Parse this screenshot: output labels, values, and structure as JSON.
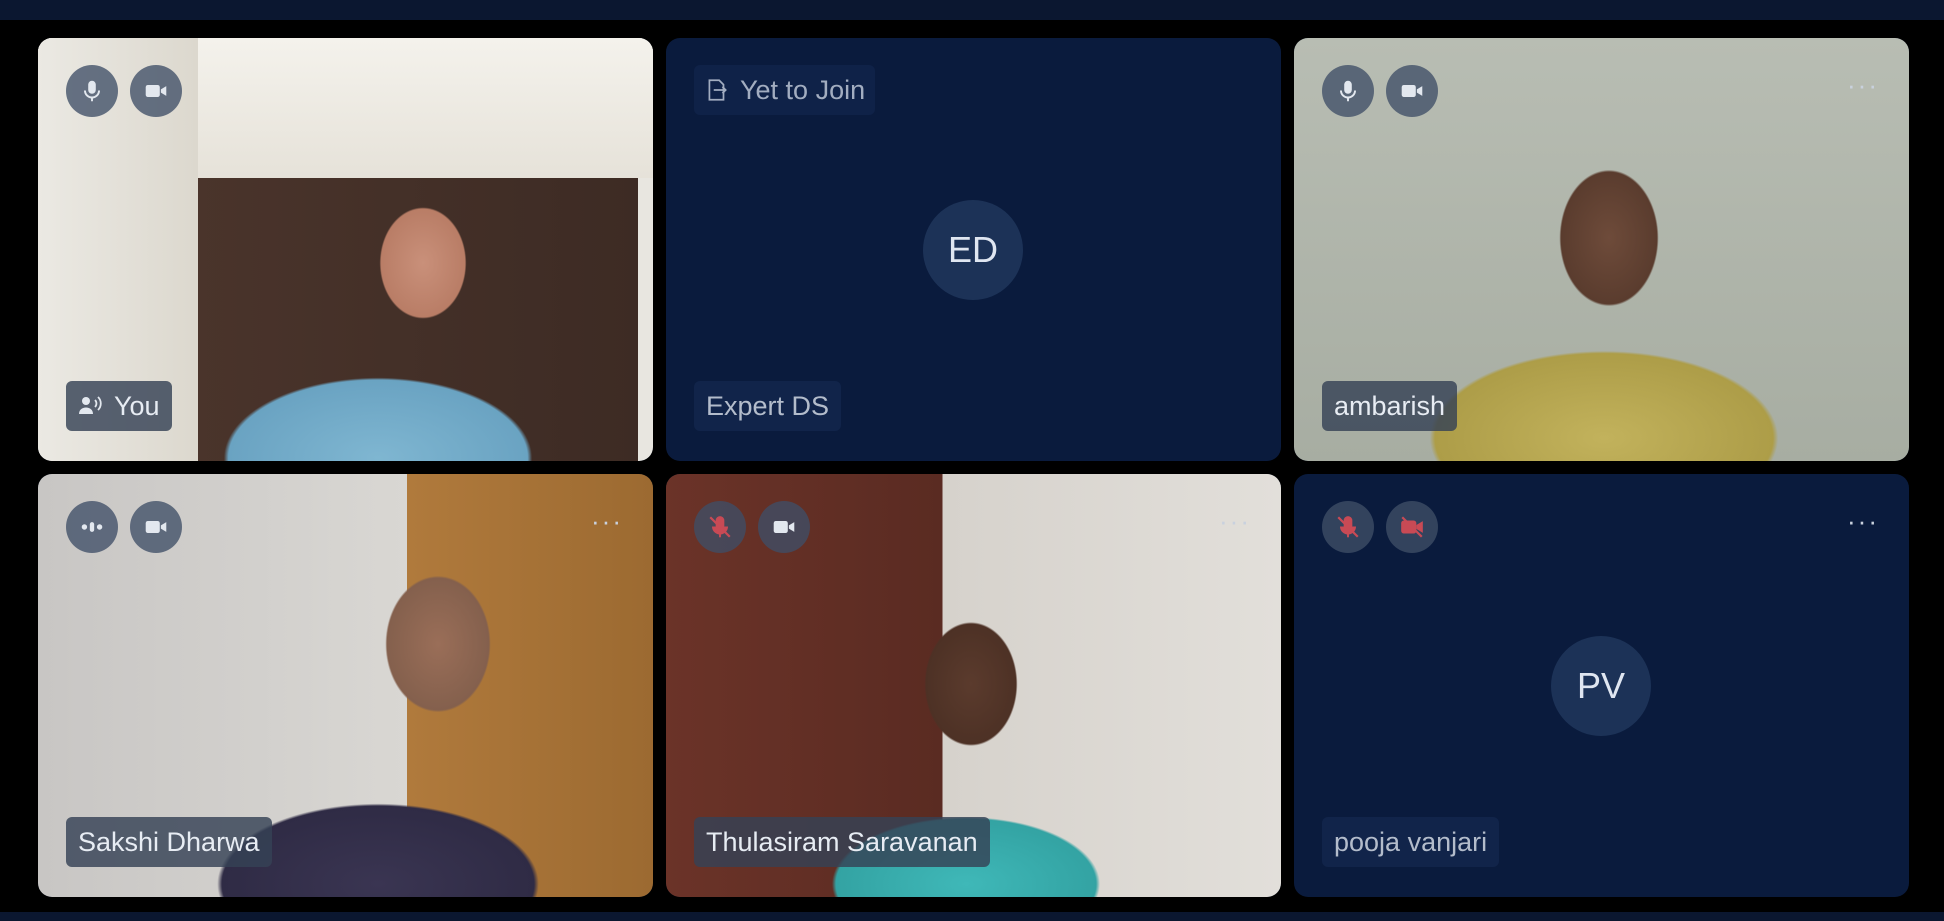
{
  "participants": [
    {
      "name": "You",
      "speaking": true,
      "mic": "on",
      "camera": "on",
      "video": true
    },
    {
      "name": "Expert DS",
      "initials": "ED",
      "status": "Yet to Join",
      "video": false
    },
    {
      "name": "ambarish",
      "mic": "on",
      "camera": "on",
      "video": true
    },
    {
      "name": "Sakshi Dharwa",
      "mic": "speaking",
      "camera": "on",
      "video": true
    },
    {
      "name": "Thulasiram Saravanan",
      "mic": "muted",
      "camera": "on",
      "video": true
    },
    {
      "name": "pooja vanjari",
      "initials": "PV",
      "mic": "muted",
      "camera": "off",
      "video": false
    }
  ],
  "more_label": "···",
  "colors": {
    "background": "#000000",
    "tile_background": "#0a1b3d",
    "muted_red": "#c84a55",
    "avatar_bg": "#1c3257"
  }
}
